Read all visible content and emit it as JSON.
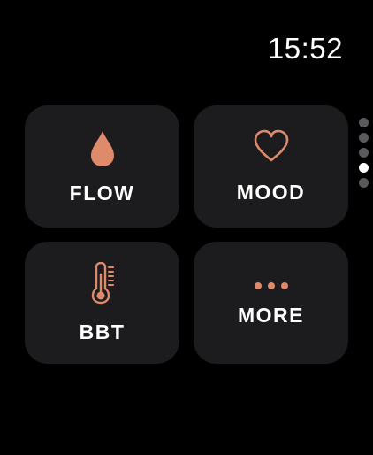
{
  "status_bar": {
    "time": "15:52"
  },
  "tiles": [
    {
      "label": "FLOW",
      "icon": "drop-icon"
    },
    {
      "label": "MOOD",
      "icon": "heart-icon"
    },
    {
      "label": "BBT",
      "icon": "thermometer-icon"
    },
    {
      "label": "MORE",
      "icon": "more-dots-icon"
    }
  ],
  "pager": {
    "total_pages": 5,
    "current_page": 4
  },
  "colors": {
    "background": "#000000",
    "tile": "#1c1c1e",
    "accent": "#e08a6c",
    "text": "#ffffff",
    "dot_inactive": "#5a5a5e",
    "dot_active": "#ffffff"
  }
}
